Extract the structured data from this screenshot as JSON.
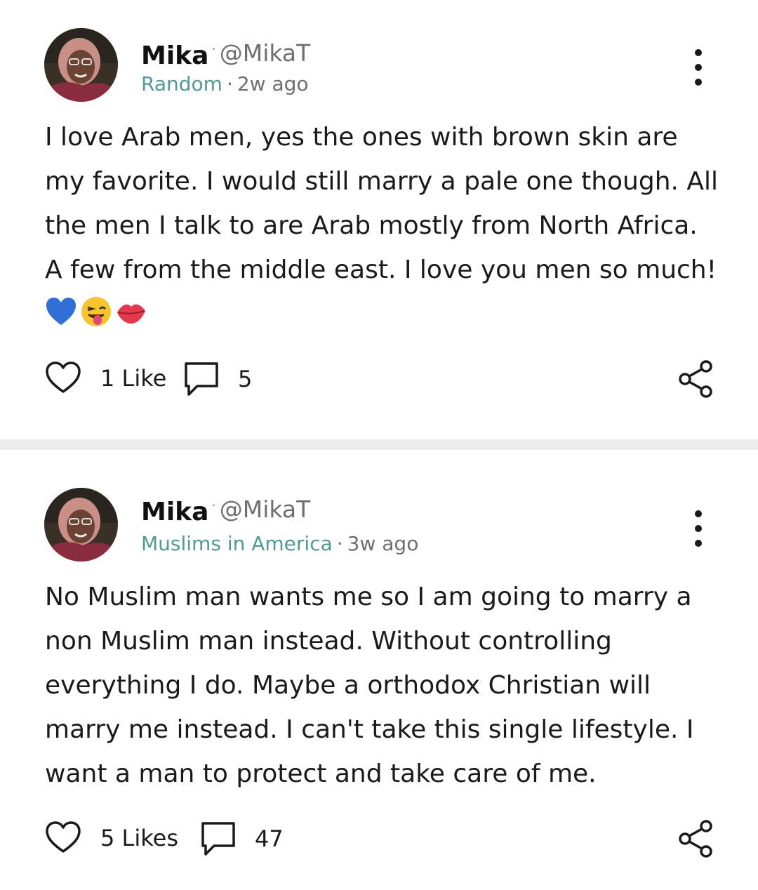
{
  "posts": [
    {
      "author": "Mika",
      "handle": "@MikaT",
      "community": "Random",
      "time": "2w ago",
      "body": "I love Arab men, yes the ones with brown skin are my favorite. I would still marry a pale one though. All the men I talk to are Arab mostly from North Africa. A few from the middle east. I love you men so much!",
      "emojis": [
        "blue-heart",
        "winking-face-with-tongue",
        "kiss-mark"
      ],
      "likes_label": "1 Like",
      "comments": "5"
    },
    {
      "author": "Mika",
      "handle": "@MikaT",
      "community": "Muslims in America",
      "time": "3w ago",
      "body": "No Muslim man wants me so I am going to marry a non Muslim man instead. Without controlling everything I do. Maybe a orthodox Christian will marry me instead. I can't take this single lifestyle. I want a man to protect and take care of me.",
      "likes_label": "5 Likes",
      "comments": "47"
    }
  ],
  "separators": {
    "name_dot": "·",
    "meta_dot": "·"
  },
  "colors": {
    "community": "#4f9a94",
    "muted": "#6f6f6f",
    "divider": "#ececec",
    "text": "#1a1a1a"
  },
  "icons": {
    "more": "more-vertical-icon",
    "like": "heart-outline-icon",
    "comment": "comment-icon",
    "share": "share-icon"
  }
}
